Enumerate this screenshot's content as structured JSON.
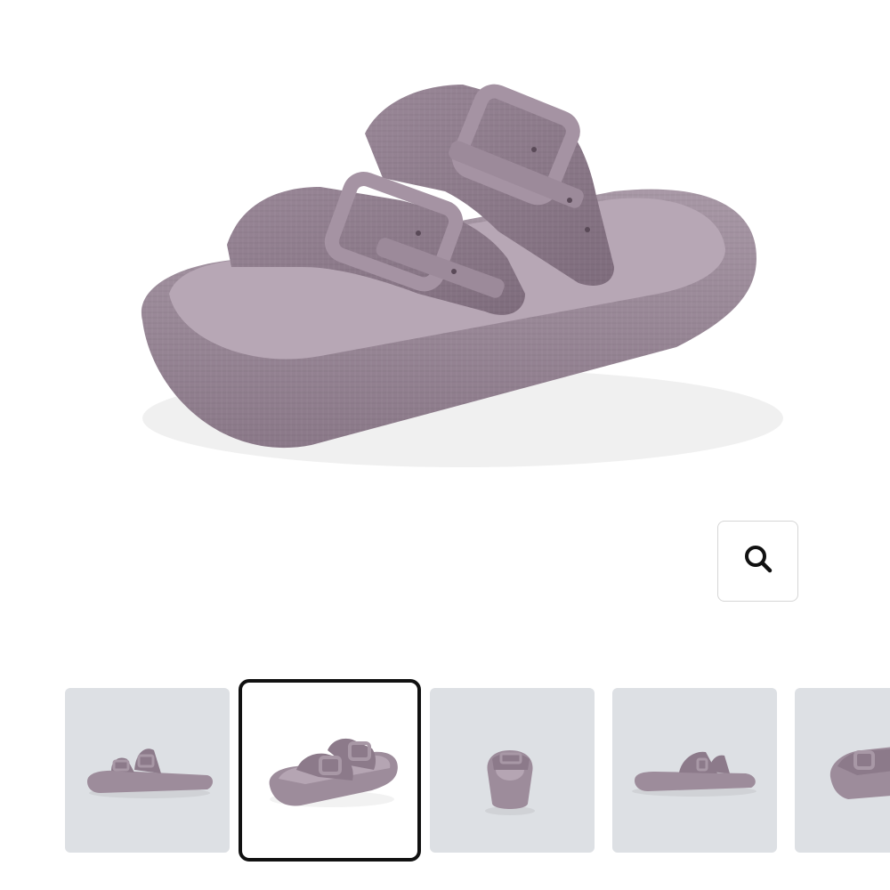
{
  "product": {
    "main_image_alt": "",
    "color": "#9a8897"
  },
  "zoom_button": {
    "icon": "search-icon"
  },
  "thumbnails": [
    {
      "view": "side-left",
      "active": false
    },
    {
      "view": "front-quarter",
      "active": true
    },
    {
      "view": "front",
      "active": false
    },
    {
      "view": "side-right",
      "active": false
    },
    {
      "view": "top-quarter",
      "active": false
    }
  ]
}
